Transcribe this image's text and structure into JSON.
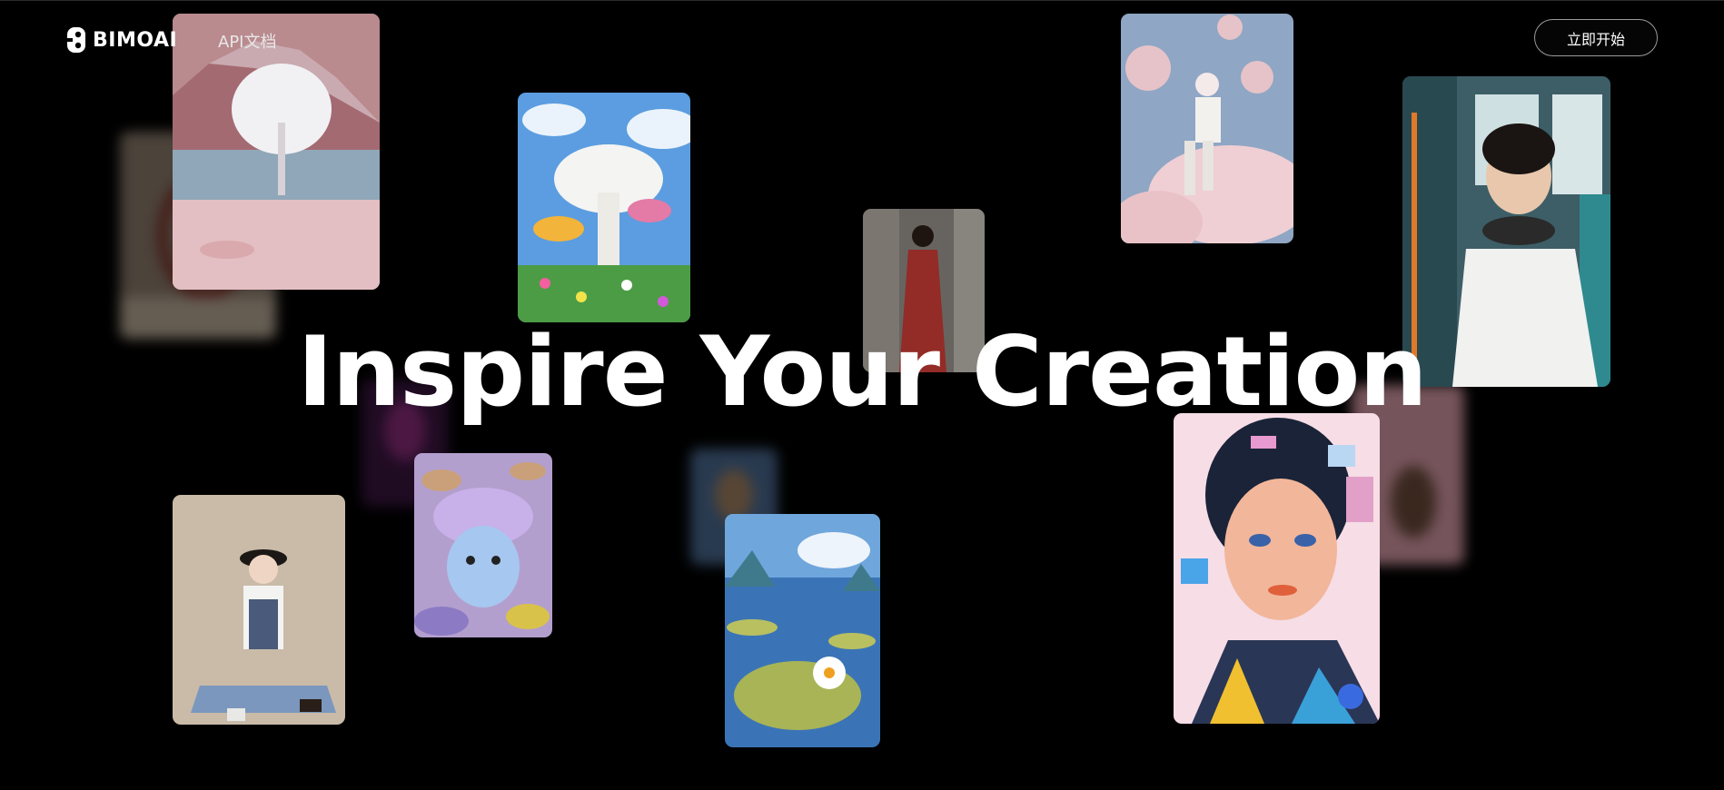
{
  "nav": {
    "logo_text": "BIMOAI",
    "api_docs_label": "API文档",
    "cta_label": "立即开始"
  },
  "hero": {
    "title": "Inspire Your Creation"
  },
  "gallery": {
    "tiles": [
      {
        "subject": "pink desert landscape with white tree"
      },
      {
        "subject": "giant white mushroom with colorful flowers"
      },
      {
        "subject": "woman in red dress on street"
      },
      {
        "subject": "woman sitting on pink clouds"
      },
      {
        "subject": "young man with headphones on tram"
      },
      {
        "subject": "girl with hat sitting on floor"
      },
      {
        "subject": "plush mushroom creature"
      },
      {
        "subject": "water lily pond illustration"
      },
      {
        "subject": "geometric pop-art portrait of woman"
      }
    ]
  },
  "colors": {
    "background": "#000000",
    "cta_border": "#9a9a9a",
    "text": "#ffffff"
  }
}
